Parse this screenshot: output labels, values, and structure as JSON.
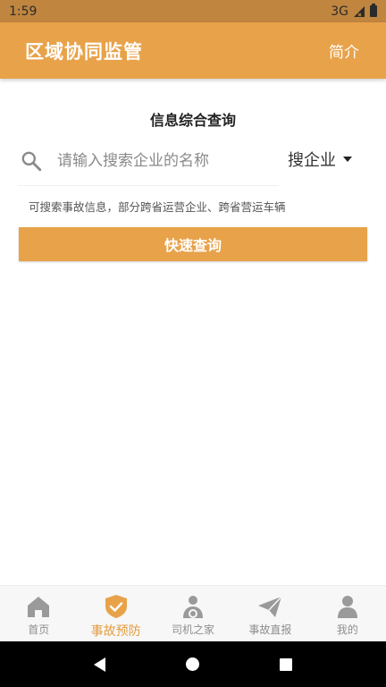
{
  "status_bar": {
    "time": "1:59",
    "network": "3G"
  },
  "app_bar": {
    "title": "区域协同监管",
    "action": "简介"
  },
  "main": {
    "section_title": "信息综合查询",
    "search": {
      "placeholder": "请输入搜索企业的名称",
      "value": ""
    },
    "scope": {
      "selected": "搜企业"
    },
    "hint": "可搜索事故信息，部分跨省运营企业、跨省营运车辆",
    "quick_button": "快速查询"
  },
  "bottom_nav": {
    "items": [
      {
        "label": "首页",
        "icon": "home-icon",
        "active": false
      },
      {
        "label": "事故预防",
        "icon": "shield-check-icon",
        "active": true
      },
      {
        "label": "司机之家",
        "icon": "driver-icon",
        "active": false
      },
      {
        "label": "事故直报",
        "icon": "paper-plane-icon",
        "active": false
      },
      {
        "label": "我的",
        "icon": "person-icon",
        "active": false
      }
    ]
  },
  "colors": {
    "primary": "#e8a24a",
    "status_bar": "#c0853f",
    "inactive": "#8e8e8e"
  }
}
